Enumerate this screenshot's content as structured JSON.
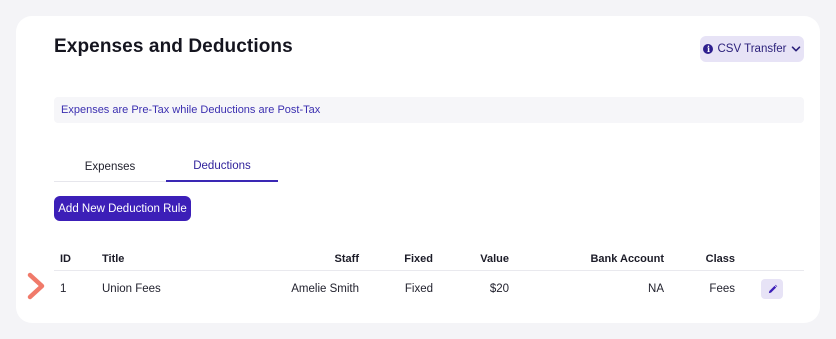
{
  "page": {
    "title": "Expenses and Deductions",
    "csv_button_label": "CSV Transfer",
    "csv_button_icon": "info-icon",
    "notice": "Expenses are Pre-Tax while Deductions are Post-Tax"
  },
  "tabs": [
    {
      "label": "Expenses",
      "active": false
    },
    {
      "label": "Deductions",
      "active": true
    }
  ],
  "add_button_label": "Add New Deduction Rule",
  "table": {
    "headers": {
      "id": "ID",
      "title": "Title",
      "staff": "Staff",
      "fixed": "Fixed",
      "value": "Value",
      "bank_account": "Bank Account",
      "class": "Class"
    },
    "rows": [
      {
        "id": "1",
        "title": "Union Fees",
        "staff": "Amelie Smith",
        "fixed": "Fixed",
        "value": "$20",
        "bank_account": "NA",
        "class": "Fees",
        "action_icon": "pencil-icon"
      }
    ]
  },
  "colors": {
    "accent": "#3c1fb8",
    "accent_soft": "#e7e3f6",
    "marker": "#f07a6a"
  }
}
